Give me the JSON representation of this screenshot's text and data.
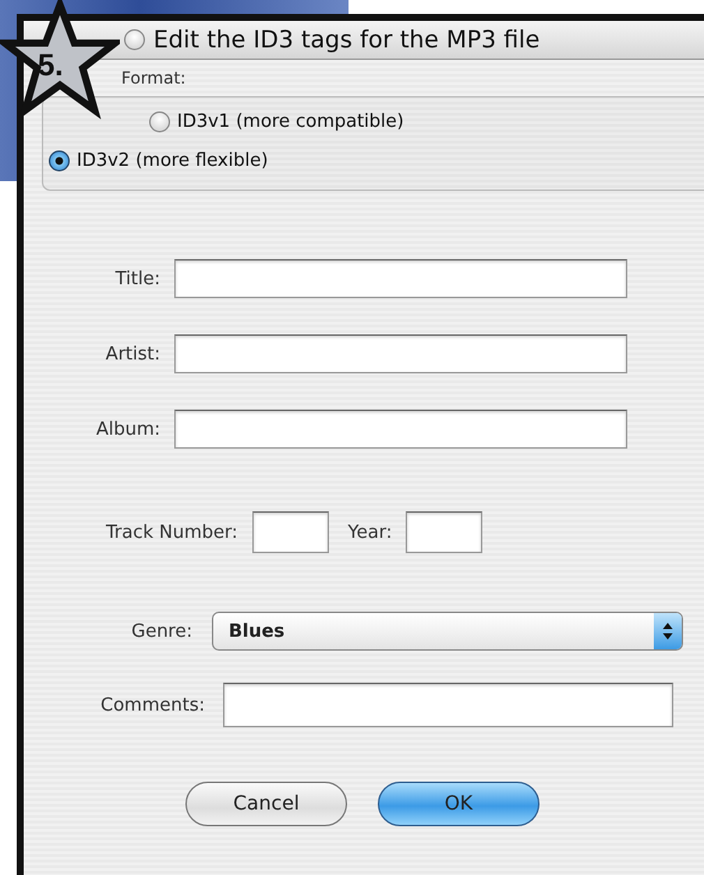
{
  "badge": {
    "label": "5."
  },
  "dialog": {
    "edit_option": {
      "label": "Edit the ID3 tags for the MP3 file",
      "checked": false
    },
    "format": {
      "label": "Format:",
      "options": [
        {
          "label": "ID3v1 (more compatible)",
          "selected": false
        },
        {
          "label": "ID3v2 (more flexible)",
          "selected": true
        }
      ]
    },
    "fields": [
      {
        "label": "Title:"
      },
      {
        "label": "Artist:"
      },
      {
        "label": "Album:"
      }
    ],
    "track_number": {
      "label": "Track Number:"
    },
    "year": {
      "label": "Year:"
    },
    "genre": {
      "label": "Genre:",
      "value": "Blues"
    },
    "comments": {
      "label": "Comments:"
    },
    "buttons": [
      {
        "label": "Cancel",
        "kind": "secondary"
      },
      {
        "label": "OK",
        "kind": "default"
      }
    ]
  }
}
